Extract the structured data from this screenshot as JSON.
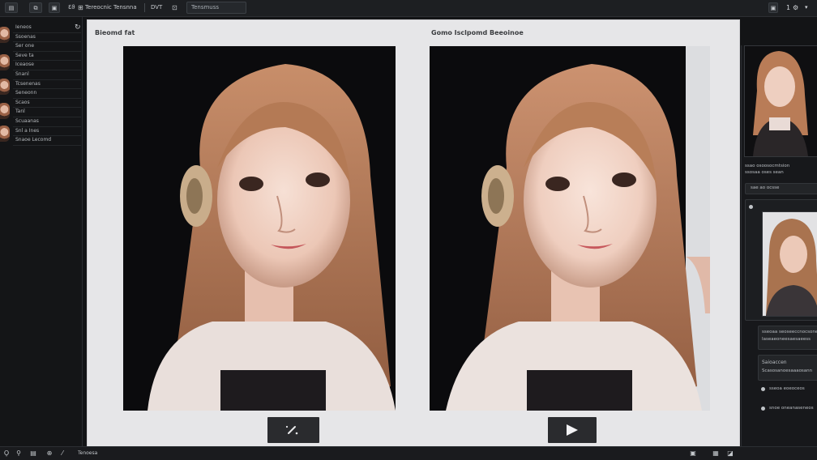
{
  "toolbar": {
    "items": [
      "▤",
      "⧉",
      "▣",
      "Ɛϑ",
      "⊞",
      "Tereocnic",
      "Tensnna",
      "DVT",
      "⊡"
    ],
    "search_value": "Tensmuss",
    "right_icons": [
      "▣",
      "1",
      "⚙"
    ]
  },
  "sidebar": {
    "refresh_icon": "↻",
    "items": [
      "Ieneos",
      "Ssoenas",
      "Ser one",
      "Seve ta",
      "Iceaose",
      "Snanl",
      "Tcsenenas",
      "Seneonn",
      "Scaos",
      "Tanl",
      "Scuaanas",
      "Snl a Ines",
      "Snaoe Lecomd"
    ]
  },
  "main": {
    "left_title": "Bieomd fat",
    "right_title": "Gomo Isclpomd Beeoinoe",
    "left_button_icon": "pencil-sparkle-icon",
    "right_button_icon": "play-icon"
  },
  "right_panel": {
    "caption_lines": [
      "ssao osoosocmtsion",
      "ssosaa oses sean"
    ],
    "section_label": "sae ao ocsse",
    "box1_text": [
      "sseoaa seoseeccnocsone",
      "Iaseaeoneesaesaeess"
    ],
    "box2_title": "Saioaccen",
    "box2_text": "Scasosanoesaaaosann",
    "row1_text": "sseoa eoeoceos",
    "row2_text": "snoe oneanaseneos"
  },
  "statusbar": {
    "items": [
      "Ϙ",
      "⚲",
      "▤",
      "⊕",
      "⁄",
      "Tenoesa"
    ],
    "right_icons": [
      "▣",
      "▦",
      "◪"
    ]
  },
  "colors": {
    "hair": "#b77a55",
    "skin": "#f0d4c6",
    "background_dark": "#0b0b0d",
    "panel_light": "#e6e6e8"
  }
}
